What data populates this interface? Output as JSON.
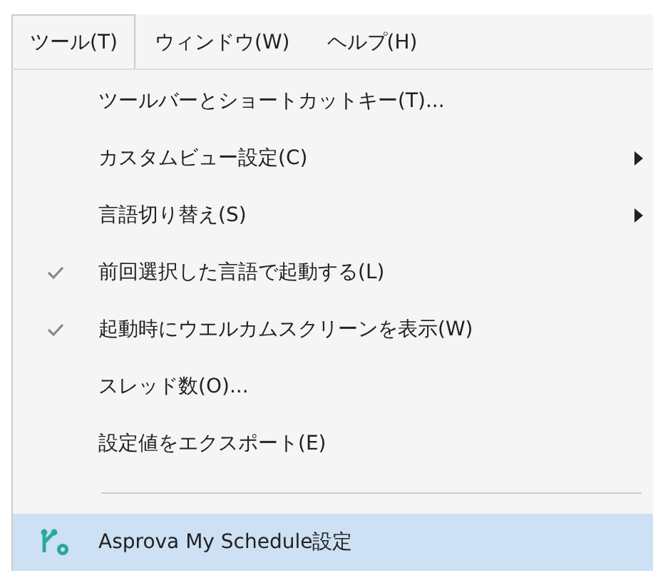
{
  "menubar": [
    {
      "label": "ツール(T)",
      "selected": true
    },
    {
      "label": "ウィンドウ(W)",
      "selected": false
    },
    {
      "label": "ヘルプ(H)",
      "selected": false
    }
  ],
  "menu": {
    "items": [
      {
        "kind": "command",
        "label": "ツールバーとショートカットキー(T)...",
        "selected": false
      },
      {
        "kind": "submenu",
        "label": "カスタムビュー設定(C)",
        "selected": false
      },
      {
        "kind": "submenu",
        "label": "言語切り替え(S)",
        "selected": false
      },
      {
        "kind": "check",
        "label": "前回選択した言語で起動する(L)",
        "checked": true,
        "selected": false
      },
      {
        "kind": "check",
        "label": "起動時にウエルカムスクリーンを表示(W)",
        "checked": true,
        "selected": false
      },
      {
        "kind": "command",
        "label": "スレッド数(O)...",
        "selected": false
      },
      {
        "kind": "command",
        "label": "設定値をエクスポート(E)",
        "selected": false
      },
      {
        "kind": "separator"
      },
      {
        "kind": "app",
        "label": "Asprova My Schedule設定",
        "selected": true
      }
    ]
  }
}
